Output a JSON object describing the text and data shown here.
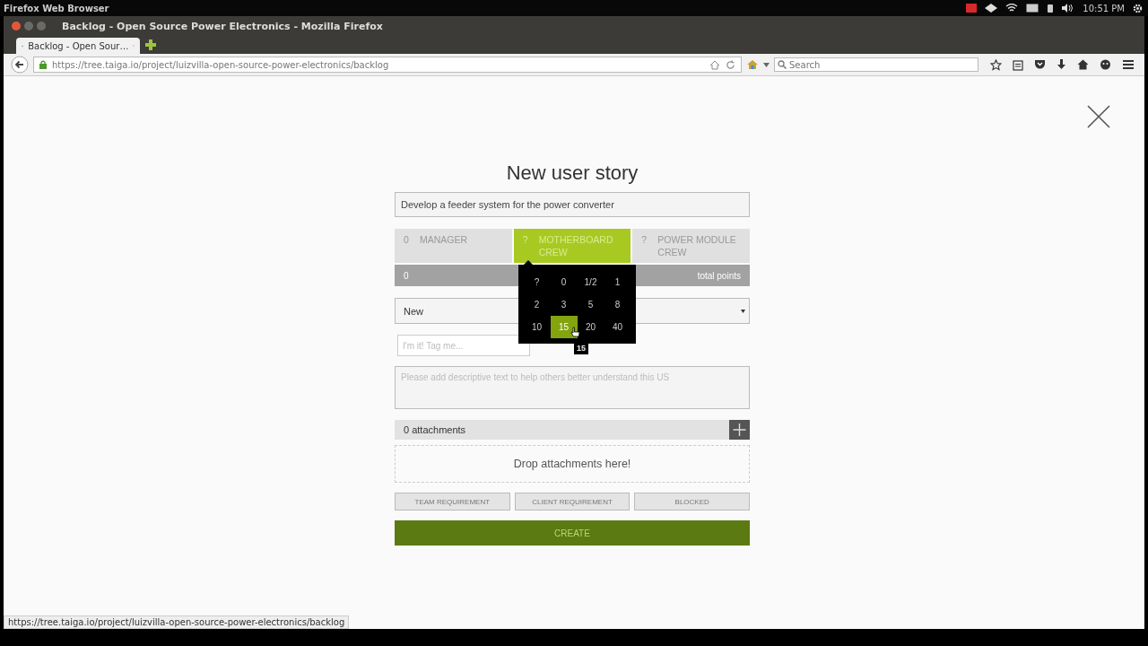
{
  "system_bar": {
    "app_name": "Firefox Web Browser",
    "time": "10:51 PM"
  },
  "window": {
    "title": "Backlog - Open Source Power Electronics - Mozilla Firefox"
  },
  "tabs": [
    {
      "label": "Backlog - Open Sour…",
      "selected": true
    }
  ],
  "address_bar": {
    "url": "https://tree.taiga.io/project/luizvilla-open-source-power-electronics/backlog"
  },
  "search": {
    "placeholder": "Search"
  },
  "dialog": {
    "title": "New user story",
    "subject": "Develop a feeder system for the power converter",
    "roles": [
      {
        "value": "0",
        "name": "MANAGER",
        "selected": false
      },
      {
        "value": "?",
        "name": "MOTHERBOARD CREW",
        "selected": true
      },
      {
        "value": "?",
        "name": "POWER MODULE CREW",
        "selected": false
      }
    ],
    "total": {
      "value": "0",
      "label": "total points"
    },
    "points_popup": {
      "options": [
        {
          "label": "?",
          "selected": false
        },
        {
          "label": "0",
          "selected": false
        },
        {
          "label": "1/2",
          "selected": false
        },
        {
          "label": "1",
          "selected": false
        },
        {
          "label": "2",
          "selected": false
        },
        {
          "label": "3",
          "selected": false
        },
        {
          "label": "5",
          "selected": false
        },
        {
          "label": "8",
          "selected": false
        },
        {
          "label": "10",
          "selected": false
        },
        {
          "label": "15",
          "selected": true
        },
        {
          "label": "20",
          "selected": false
        },
        {
          "label": "40",
          "selected": false
        }
      ],
      "tooltip": "15"
    },
    "status": "New",
    "tags_placeholder": "I'm it! Tag me...",
    "description_placeholder": "Please add descriptive text to help others better understand this US",
    "attachments": {
      "count_label": "0 attachments",
      "drop_label": "Drop attachments here!"
    },
    "toggles": [
      "TEAM REQUIREMENT",
      "CLIENT REQUIREMENT",
      "BLOCKED"
    ],
    "create_label": "CREATE"
  },
  "status_url": "https://tree.taiga.io/project/luizvilla-open-source-power-electronics/backlog"
}
